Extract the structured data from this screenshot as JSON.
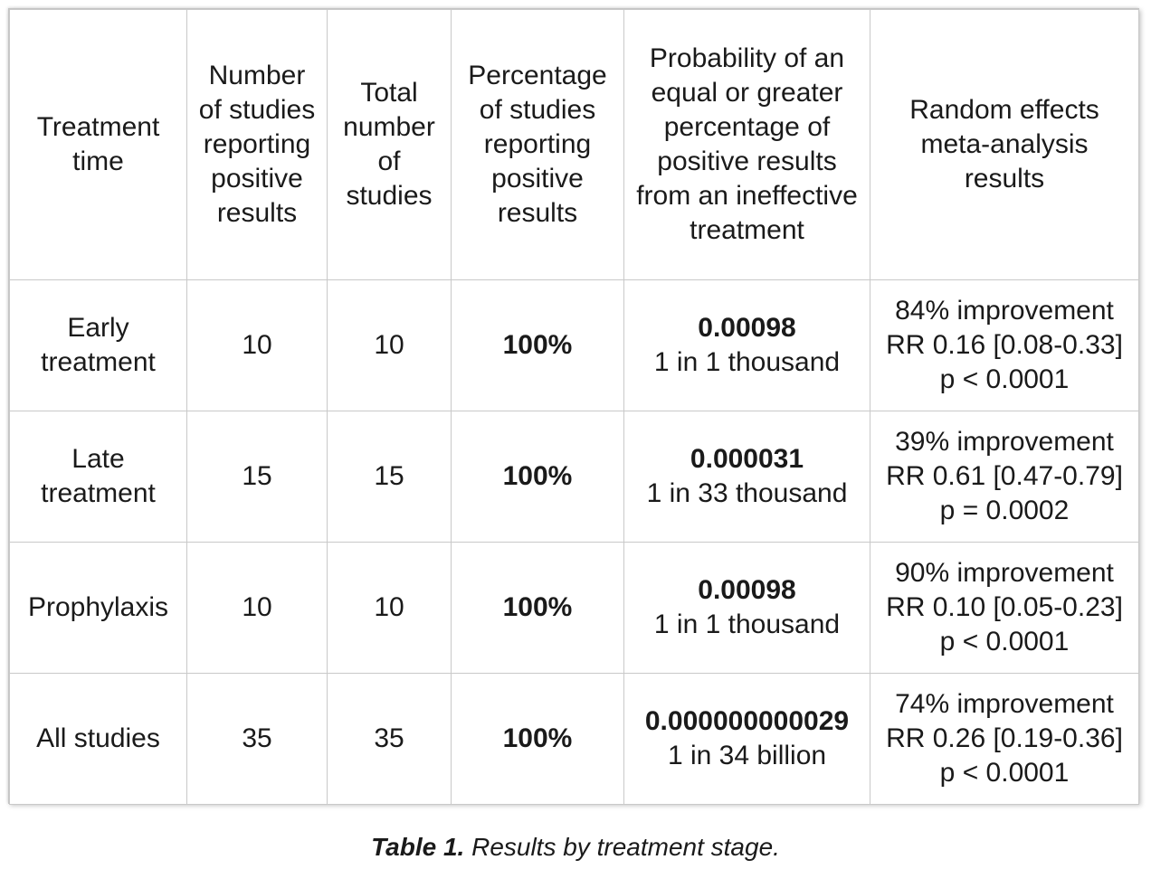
{
  "table": {
    "columns": [
      "Treatment time",
      "Number of studies reporting positive results",
      "Total number of studies",
      "Percentage of studies reporting positive results",
      "Probability of an equal or greater percentage of positive results from an ineffective treatment",
      "Random effects meta-analysis results"
    ],
    "rows": [
      {
        "treatment_time": "Early treatment",
        "studies_positive": "10",
        "total_studies": "10",
        "percentage_positive": "100%",
        "probability_value": "0.00098",
        "probability_words": "1 in 1 thousand",
        "improvement": "84%",
        "improvement_label": " improvement",
        "rr": "RR 0.16 [0.08-0.33]",
        "p_value": "p < 0.0001",
        "improvement_bold": true
      },
      {
        "treatment_time": "Late treatment",
        "studies_positive": "15",
        "total_studies": "15",
        "percentage_positive": "100%",
        "probability_value": "0.000031",
        "probability_words": "1 in 33 thousand",
        "improvement": "39%",
        "improvement_label": " improvement",
        "rr": "RR 0.61 [0.47-0.79]",
        "p_value": "p = 0.0002",
        "improvement_bold": false
      },
      {
        "treatment_time": "Prophylaxis",
        "studies_positive": "10",
        "total_studies": "10",
        "percentage_positive": "100%",
        "probability_value": "0.00098",
        "probability_words": "1 in 1 thousand",
        "improvement": "90%",
        "improvement_label": " improvement",
        "rr": "RR 0.10 [0.05-0.23]",
        "p_value": "p < 0.0001",
        "improvement_bold": true
      },
      {
        "treatment_time": "All studies",
        "studies_positive": "35",
        "total_studies": "35",
        "percentage_positive": "100%",
        "probability_value": "0.000000000029",
        "probability_words": "1 in 34 billion",
        "improvement": "74%",
        "improvement_label": " improvement",
        "rr": "RR 0.26 [0.19-0.36]",
        "p_value": "p < 0.0001",
        "improvement_bold": true
      }
    ],
    "shading": {
      "shaded_color": "#efefef",
      "plain_color": "#ffffff",
      "border_color": "#c9c9c9"
    }
  },
  "caption": {
    "label": "Table 1.",
    "text": " Results by treatment stage."
  }
}
